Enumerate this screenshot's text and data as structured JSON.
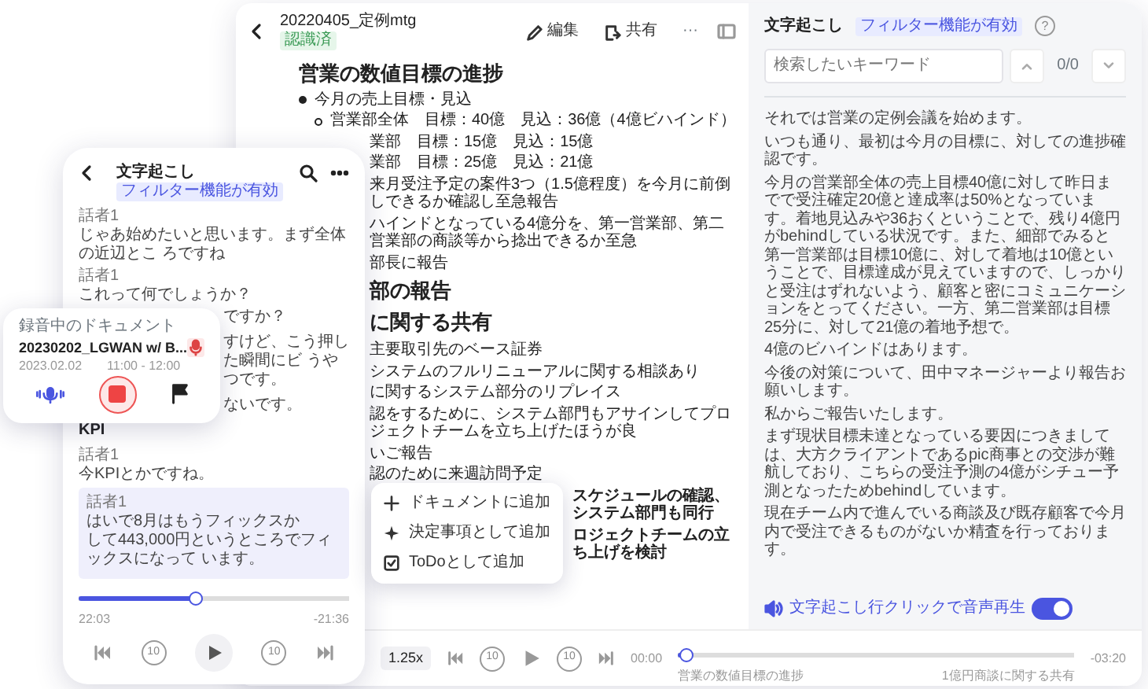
{
  "desktop": {
    "title": "20220405_定例mtg",
    "status_badge": "認識済",
    "actions": [
      {
        "label": "編集"
      },
      {
        "label": "共有"
      }
    ],
    "more": "···",
    "document": [
      {
        "kind": "heading",
        "text": "営業の数値目標の進捗"
      },
      {
        "kind": "bullet",
        "text": "今月の売上目標・見込"
      },
      {
        "kind": "sub",
        "text": "営業部全体　目標：40億　見込：36億（4億ビハインド）"
      },
      {
        "kind": "clip",
        "text": "業部　目標：15億　見込：15億"
      },
      {
        "kind": "clip",
        "text": "業部　目標：25億　見込：21億"
      },
      {
        "kind": "clip",
        "text": "来月受注予定の案件3つ（1.5億程度）を今月に前倒しできるか確認し至急報告"
      },
      {
        "kind": "clip",
        "text": "ハインドとなっている4億分を、第一営業部、第二営業部の商談等から捻出できるか至急"
      },
      {
        "kind": "clip",
        "text": "部長に報告"
      },
      {
        "kind": "clip_heading",
        "text": "部の報告"
      },
      {
        "kind": "clip_heading",
        "text": "に関する共有"
      },
      {
        "kind": "clip",
        "text": "主要取引先のベース証券"
      },
      {
        "kind": "clip",
        "text": "システムのフルリニューアルに関する相談あり"
      },
      {
        "kind": "clip",
        "text": "に関するシステム部分のリプレイス"
      },
      {
        "kind": "clip",
        "text": "認をするために、システム部門もアサインしてプロジェクトチームを立ち上げたほうが良"
      },
      {
        "kind": "clip",
        "text": "いご報告"
      },
      {
        "kind": "clip",
        "text": "認のために来週訪問予定"
      },
      {
        "kind": "clip_bold",
        "text": "スケジュールの確認、システム部門も同行"
      },
      {
        "kind": "clip_bold",
        "text": "ロジェクトチームの立ち上げを検討"
      }
    ],
    "player": {
      "speed": "1.25x",
      "rewind_label": "10",
      "forward_label": "10",
      "elapsed": "00:00",
      "remaining": "-03:20",
      "level": 0.02,
      "chapters": [
        {
          "label": "営業の数値目標の進捗"
        },
        {
          "label": "1億円商談に関する共有"
        }
      ]
    }
  },
  "transcript_panel": {
    "title": "文字起こし",
    "filter_badge": "フィルター機能が有効",
    "help": "?",
    "search": {
      "placeholder": "検索したいキーワード",
      "count": "0/0"
    },
    "paragraphs": [
      "それでは営業の定例会議を始めます。",
      "いつも通り、最初は今月の目標に、対しての進捗確認です。",
      "今月の営業部全体の売上目標40億に対して昨日までで受注確定20億と達成率は50%となっています。着地見込みや36おくということで、残り4億円がbehindしている状況です。また、細部でみると第一営業部は目標10億に、対して着地は10億ということで、目標達成が見えていますので、しっかりと受注はずれないよう、顧客と密にコミュニケーションをとってください。一方、第二営業部は目標25分に、対して21億の着地予想で。",
      "4億のビハインドはあります。",
      "今後の対策について、田中マネージャーより報告お願いします。",
      "私からご報告いたします。",
      "まず現状目標未達となっている要因につきましては、大方クライアントであるpic商事との交渉が難航しており、こちらの受注予測の4億がシチュー予測となったためbehindしています。",
      "現在チーム内で進んでいる商談及び既存顧客で今月内で受注できるものがないか精査を行っております。"
    ],
    "playback_toggle": {
      "label": "文字起こし行クリックで音声再生",
      "on": true
    }
  },
  "phone": {
    "title": "文字起こし",
    "filter_badge": "フィルター機能が有効",
    "entries": [
      {
        "kind": "utterance",
        "speaker": "話者1",
        "text": "じゃあ始めたいと思います。まず全体の近辺とこ ろですね",
        "selected": false
      },
      {
        "kind": "utterance",
        "speaker": "話者1",
        "text": "これって何でしょうか？",
        "selected": false
      },
      {
        "kind": "fragment",
        "text": "ですか？",
        "selected": false
      },
      {
        "kind": "fragment",
        "text": "すけど、こう押した瞬間にビ うやつです。",
        "selected": false
      },
      {
        "kind": "fragment",
        "text": "ないです。",
        "selected": false
      },
      {
        "kind": "section",
        "text": "KPI",
        "selected": false
      },
      {
        "kind": "utterance",
        "speaker": "話者1",
        "text": "今KPIとかですね。",
        "selected": false
      },
      {
        "kind": "utterance",
        "speaker": "話者1",
        "text": "はいで8月はもうフィックスか",
        "more": "して443,000円というところでフィックスになって います。",
        "selected": true
      }
    ],
    "player": {
      "elapsed": "22:03",
      "remaining": "-21:36",
      "level": 0.43,
      "rewind_label": "10",
      "forward_label": "10"
    }
  },
  "recording_card": {
    "label": "録音中のドキュメント",
    "title": "20230202_LGWAN w/ B...",
    "date": "2023.02.02",
    "time": "11:00 - 12:00"
  },
  "context_menu": [
    {
      "label": "ドキュメントに追加"
    },
    {
      "label": "決定事項として追加"
    },
    {
      "label": "ToDoとして追加"
    }
  ]
}
